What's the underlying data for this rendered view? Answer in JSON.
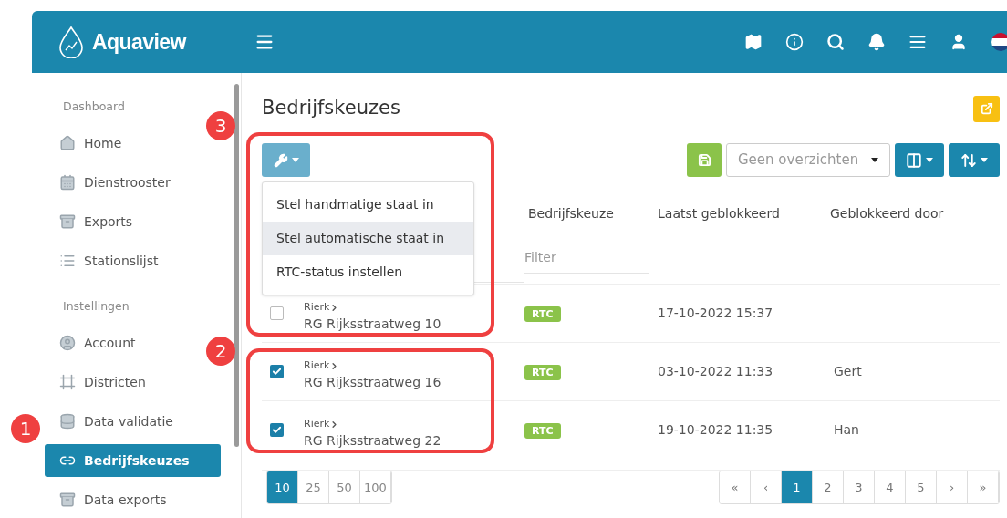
{
  "header": {
    "logo_text": "Aquaview"
  },
  "sidebar": {
    "sections": [
      {
        "label": "Dashboard",
        "items": [
          {
            "label": "Home",
            "selected": false
          },
          {
            "label": "Dienstrooster",
            "selected": false
          },
          {
            "label": "Exports",
            "selected": false
          },
          {
            "label": "Stationslijst",
            "selected": false
          }
        ]
      },
      {
        "label": "Instellingen",
        "items": [
          {
            "label": "Account",
            "selected": false
          },
          {
            "label": "Districten",
            "selected": false
          },
          {
            "label": "Data validatie",
            "selected": false
          },
          {
            "label": "Bedrijfskeuzes",
            "selected": true
          },
          {
            "label": "Data exports",
            "selected": false
          }
        ]
      }
    ]
  },
  "page": {
    "title": "Bedrijfskeuzes"
  },
  "actions_menu": {
    "items": [
      {
        "label": "Stel handmatige staat in",
        "highlighted": false
      },
      {
        "label": "Stel automatische staat in",
        "highlighted": true
      },
      {
        "label": "RTC-status instellen",
        "highlighted": false
      }
    ]
  },
  "view_select": {
    "value": "Geen overzichten"
  },
  "table": {
    "columns": [
      {
        "label": "Bedrijfskeuze",
        "filter_placeholder": "Filter"
      },
      {
        "label": "Laatst geblokkeerd"
      },
      {
        "label": "Geblokkeerd door"
      }
    ],
    "rows": [
      {
        "checked": false,
        "parent": "Rierk",
        "name": "RG Rijksstraatweg 10",
        "tag": "RTC",
        "blocked_at": "17-10-2022 15:37",
        "blocked_by": ""
      },
      {
        "checked": true,
        "parent": "Rierk",
        "name": "RG Rijksstraatweg 16",
        "tag": "RTC",
        "blocked_at": "03-10-2022 11:33",
        "blocked_by": "Gert"
      },
      {
        "checked": true,
        "parent": "Rierk",
        "name": "RG Rijksstraatweg 22",
        "tag": "RTC",
        "blocked_at": "19-10-2022 11:35",
        "blocked_by": "Han"
      }
    ]
  },
  "pagination": {
    "page_sizes": [
      {
        "label": "10",
        "selected": true
      },
      {
        "label": "25",
        "selected": false
      },
      {
        "label": "50",
        "selected": false
      },
      {
        "label": "100",
        "selected": false
      }
    ],
    "pages": [
      {
        "label": "«",
        "selected": false
      },
      {
        "label": "‹",
        "selected": false
      },
      {
        "label": "1",
        "selected": true
      },
      {
        "label": "2",
        "selected": false
      },
      {
        "label": "3",
        "selected": false
      },
      {
        "label": "4",
        "selected": false
      },
      {
        "label": "5",
        "selected": false
      },
      {
        "label": "›",
        "selected": false
      },
      {
        "label": "»",
        "selected": false
      }
    ]
  },
  "annotations": [
    {
      "number": "3"
    },
    {
      "number": "2"
    },
    {
      "number": "1"
    }
  ]
}
